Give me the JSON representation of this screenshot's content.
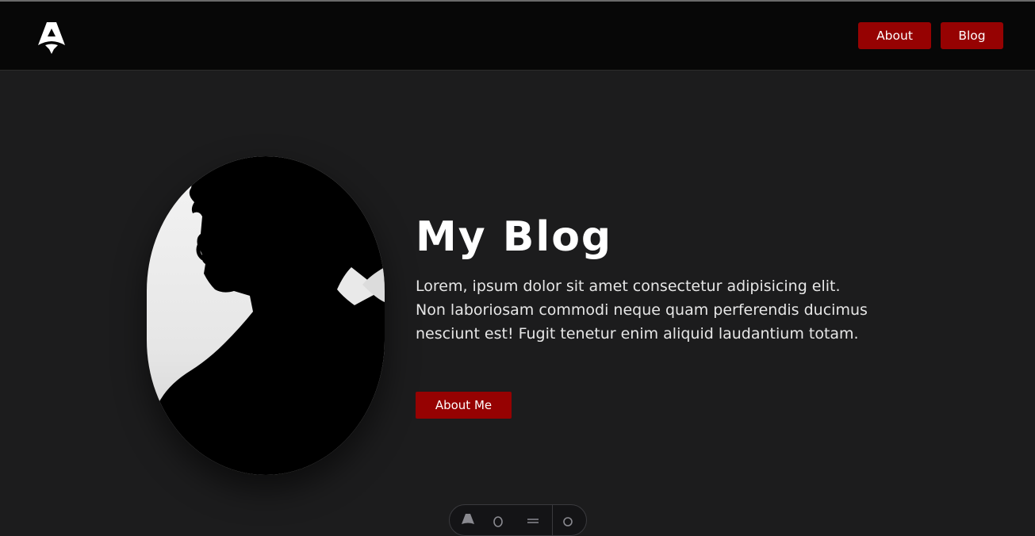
{
  "brand": {
    "logo_icon": "astro-logo-icon"
  },
  "nav": {
    "about_label": "About",
    "blog_label": "Blog"
  },
  "hero": {
    "title": "My Blog",
    "description": "Lorem, ipsum dolor sit amet consectetur adipisicing elit. Non laboriosam commodi neque quam perferendis ducimus nesciunt est! Fugit tenetur enim aliquid laudantium totam.",
    "cta_label": "About Me",
    "portrait_icon": "silhouette-portrait"
  },
  "devbar": {
    "icons": [
      "astro-icon",
      "bug-icon",
      "list-icon",
      "settings-icon"
    ]
  },
  "colors": {
    "accent": "#960202",
    "nav_bg": "#070707",
    "page_bg": "#1c1c1d"
  }
}
